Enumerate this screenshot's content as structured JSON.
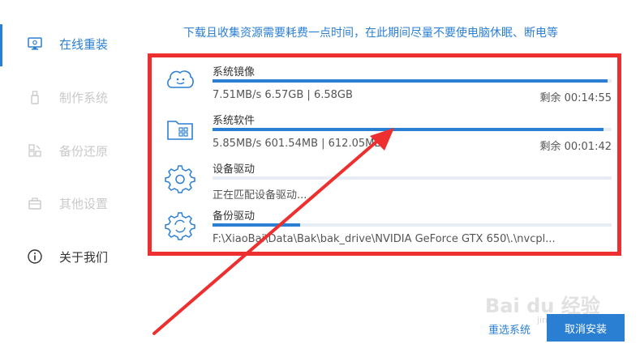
{
  "sidebar": {
    "items": [
      {
        "label": "在线重装",
        "icon": "monitor-icon",
        "state": "active"
      },
      {
        "label": "制作系统",
        "icon": "usb-drive-icon",
        "state": "disabled"
      },
      {
        "label": "备份还原",
        "icon": "backup-grid-icon",
        "state": "disabled"
      },
      {
        "label": "其他设置",
        "icon": "briefcase-icon",
        "state": "disabled"
      },
      {
        "label": "关于我们",
        "icon": "info-icon",
        "state": "normal"
      }
    ]
  },
  "notice": "下载且收集资源需要耗费一点时间，在此期间尽量不要使电脑休眠、断电等",
  "downloads": [
    {
      "name": "系统镜像",
      "info": "7.51MB/s 6.57GB | 6.58GB",
      "remaining": "剩余 00:14:55",
      "progress": 0.99,
      "icon": "smiley-cloud-icon"
    },
    {
      "name": "系统软件",
      "info": "5.85MB/s 601.54MB | 612.05MB",
      "remaining": "剩余 00:01:42",
      "progress": 0.98,
      "icon": "folder-apps-icon"
    },
    {
      "name": "设备驱动",
      "info": "正在匹配设备驱动...",
      "remaining": "",
      "progress": 0.0,
      "icon": "gear-icon"
    },
    {
      "name": "备份驱动",
      "info": "F:\\XiaoBai\\Data\\Bak\\bak_drive\\NVIDIA GeForce GTX 650\\.\\nvcpl...",
      "remaining": "",
      "progress": 0.22,
      "icon": "gear-sync-icon"
    }
  ],
  "buttons": {
    "reselect": "重选系统",
    "cancel": "取消安装"
  },
  "watermark": {
    "text": "Bai du 经验",
    "sub": "jingyan.baidu.com"
  },
  "colors": {
    "accent": "#2b7fd3",
    "annotation": "#ee2f2f",
    "track": "#e6edf5"
  }
}
